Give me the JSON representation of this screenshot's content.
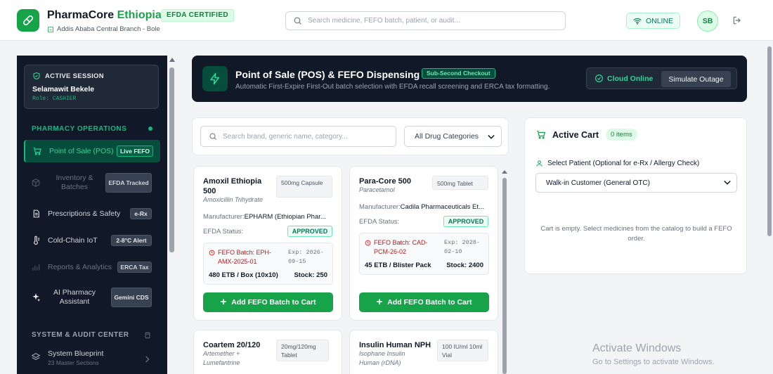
{
  "header": {
    "brand_main": "PharmaCore",
    "brand_accent": "Ethiopia",
    "certified_badge": "EFDA CERTIFIED",
    "branch": "Addis Ababa Central Branch - Bole",
    "search_placeholder": "Search medicine, FEFO batch, patient, or audit...",
    "status": "ONLINE",
    "avatar_initials": "SB"
  },
  "sidebar": {
    "session_label": "ACTIVE SESSION",
    "user_name": "Selamawit Bekele",
    "role": "Role: CASHIER",
    "section_ops": "PHARMACY OPERATIONS",
    "items": [
      {
        "label": "Point of Sale (POS)",
        "badge": "Live FEFO"
      },
      {
        "label": "Inventory & Batches",
        "badge": "EFDA Tracked"
      },
      {
        "label": "Prescriptions & Safety",
        "badge": "e-Rx"
      },
      {
        "label": "Cold-Chain IoT",
        "badge": "2-8°C Alert"
      },
      {
        "label": "Reports & Analytics",
        "badge": "ERCA Tax"
      },
      {
        "label": "AI Pharmacy Assistant",
        "badge": "Gemini CDS"
      }
    ],
    "section_system": "SYSTEM & AUDIT CENTER",
    "system_items": [
      {
        "label": "System Blueprint",
        "sub": "23 Master Sections"
      }
    ]
  },
  "hero": {
    "title": "Point of Sale (POS) & FEFO Dispensing",
    "tag": "Sub-Second Checkout",
    "subtitle": "Automatic First-Expire First-Out batch selection with EFDA recall screening and ERCA tax formatting.",
    "cloud_status": "Cloud Online",
    "simulate_button": "Simulate Outage"
  },
  "catalog": {
    "search_placeholder": "Search brand, generic name, category...",
    "category_selected": "All Drug Categories",
    "manufacturer_label": "Manufacturer:",
    "status_label": "EFDA Status:",
    "add_button": "Add FEFO Batch to Cart",
    "products": [
      {
        "name": "Amoxil Ethiopia 500",
        "generic": "Amoxicillin Trihydrate",
        "form": "500mg Capsule",
        "manufacturer": "EPHARM (Ethiopian Phar...",
        "status": "APPROVED",
        "batch": "FEFO Batch: EPH-AMX-2025-01",
        "expiry": "Exp: 2026-09-15",
        "price": "480 ETB / Box (10x10)",
        "stock": "Stock: 250"
      },
      {
        "name": "Para-Core 500",
        "generic": "Paracetamol",
        "form": "500mg Tablet",
        "manufacturer": "Cadila Pharmaceuticals Et...",
        "status": "APPROVED",
        "batch": "FEFO Batch: CAD-PCM-26-02",
        "expiry": "Exp: 2028-02-10",
        "price": "45 ETB / Blister Pack",
        "stock": "Stock: 2400"
      },
      {
        "name": "Coartem 20/120",
        "generic": "Artemether + Lumefantrine",
        "form": "20mg/120mg Tablet"
      },
      {
        "name": "Insulin Human NPH",
        "generic": "Isophane Insulin Human (rDNA)",
        "form": "100 IU/ml 10ml Vial"
      }
    ]
  },
  "cart": {
    "title": "Active Cart",
    "count": "0 items",
    "patient_label": "Select Patient (Optional for e-Rx / Allergy Check)",
    "patient_selected": "Walk-in Customer (General OTC)",
    "empty_text": "Cart is empty. Select medicines from the catalog to build a FEFO order."
  },
  "watermark": {
    "line1": "Activate Windows",
    "line2": "Go to Settings to activate Windows."
  },
  "colors": {
    "accent": "#16a34a",
    "sidebar_bg": "#111827",
    "approved": "#047857",
    "batch_red": "#b91c1c"
  }
}
